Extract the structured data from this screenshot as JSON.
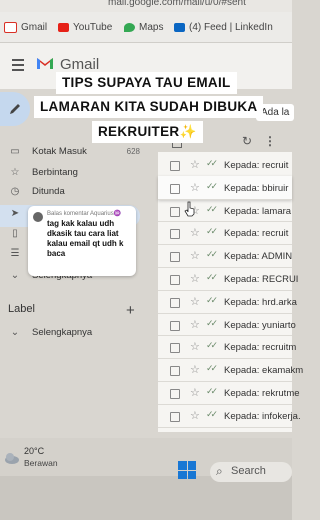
{
  "browser": {
    "url": "mail.google.com/mail/u/0/#sent",
    "bookmarks": [
      {
        "label": "Gmail",
        "icon": "gmail-icon",
        "color": "#d93025"
      },
      {
        "label": "YouTube",
        "icon": "youtube-icon",
        "color": "#e62117"
      },
      {
        "label": "Maps",
        "icon": "maps-icon",
        "color": "#34a853"
      },
      {
        "label": "(4) Feed | LinkedIn",
        "icon": "linkedin-icon",
        "color": "#0a66c2"
      }
    ]
  },
  "gmail": {
    "logo_text": "Gmail",
    "search_chip": "Ada la",
    "nav": [
      {
        "label": "Kotak Masuk",
        "count": "628",
        "icon": "inbox-icon"
      },
      {
        "label": "Berbintang",
        "icon": "star-icon"
      },
      {
        "label": "Ditunda",
        "icon": "clock-icon"
      },
      {
        "label": "",
        "icon": "send-icon"
      },
      {
        "label": "",
        "icon": "draft-icon"
      },
      {
        "label": "",
        "icon": "more-icon"
      },
      {
        "label": "Selengkapnya",
        "icon": "chevron-down-icon"
      }
    ],
    "labels_heading": "Label",
    "labels_more": "Selengkapnya",
    "mails": [
      {
        "to": "Kepada: recruit"
      },
      {
        "to": "Kepada: bbiruir"
      },
      {
        "to": "Kepada: lamara"
      },
      {
        "to": "Kepada: recruit"
      },
      {
        "to": "Kepada: ADMIN"
      },
      {
        "to": "Kepada: RECRUI"
      },
      {
        "to": "Kepada: hrd.arka"
      },
      {
        "to": "Kepada: yuniarto"
      },
      {
        "to": "Kepada: recruitm"
      },
      {
        "to": "Kepada: ekamakm"
      },
      {
        "to": "Kepada: rekrutme"
      },
      {
        "to": "Kepada: infokerja."
      }
    ]
  },
  "overlay": {
    "title_lines": [
      "TIPS SUPAYA TAU EMAIL",
      "LAMARAN KITA SUDAH DIBUKA",
      "REKRUITER✨"
    ],
    "reply_header": "Balas komentar Aquarius♒",
    "reply_text": "tag kak kalau udh dkasik tau cara liat kalau email qt udh k baca"
  },
  "taskbar": {
    "temperature": "20°C",
    "weather": "Berawan",
    "search_label": "Search"
  }
}
